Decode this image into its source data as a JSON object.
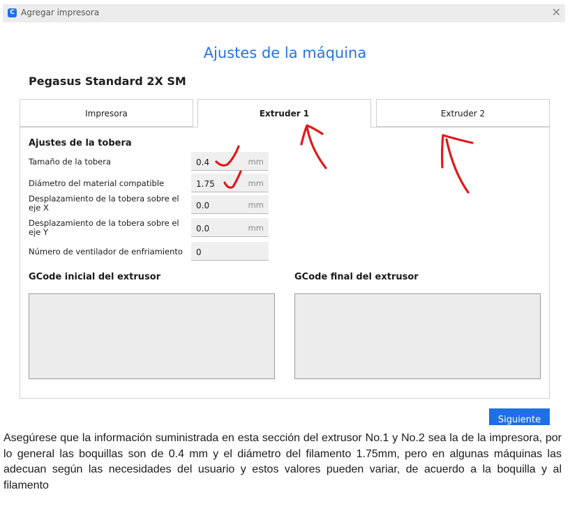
{
  "window": {
    "title": "Agregar impresora",
    "app_icon_letter": "C",
    "close_glyph": "✕"
  },
  "heading": "Ajustes de la máquina",
  "machine_name": "Pegasus Standard 2X SM",
  "tabs": [
    {
      "label": "Impresora",
      "active": false
    },
    {
      "label": "Extruder 1",
      "active": true
    },
    {
      "label": "Extruder 2",
      "active": false
    }
  ],
  "nozzle_section": {
    "title": "Ajustes de la tobera",
    "fields": [
      {
        "label": "Tamaño de la tobera",
        "value": "0.4",
        "unit": "mm"
      },
      {
        "label": "Diámetro del material compatible",
        "value": "1.75",
        "unit": "mm"
      },
      {
        "label": "Desplazamiento de la tobera sobre el eje X",
        "value": "0.0",
        "unit": "mm"
      },
      {
        "label": "Desplazamiento de la tobera sobre el eje Y",
        "value": "0.0",
        "unit": "mm"
      },
      {
        "label": "Número de ventilador de enfriamiento",
        "value": "0",
        "unit": ""
      }
    ]
  },
  "gcode": {
    "start_title": "GCode inicial del extrusor",
    "start_value": "",
    "end_title": "GCode final del extrusor",
    "end_value": ""
  },
  "next_button": "Siguiente",
  "caption": "Asegúrese que la información suministrada en esta sección del extrusor No.1 y No.2 sea la de la impresora, por lo general las boquillas son de 0.4 mm y el diámetro del filamento 1.75mm, pero en algunas máquinas las adecuan según las necesidades del usuario y estos valores pueden variar, de acuerdo a la boquilla y al filamento",
  "colors": {
    "accent": "#1f6fe5",
    "heading": "#2473e0",
    "annotation": "#e01818"
  }
}
